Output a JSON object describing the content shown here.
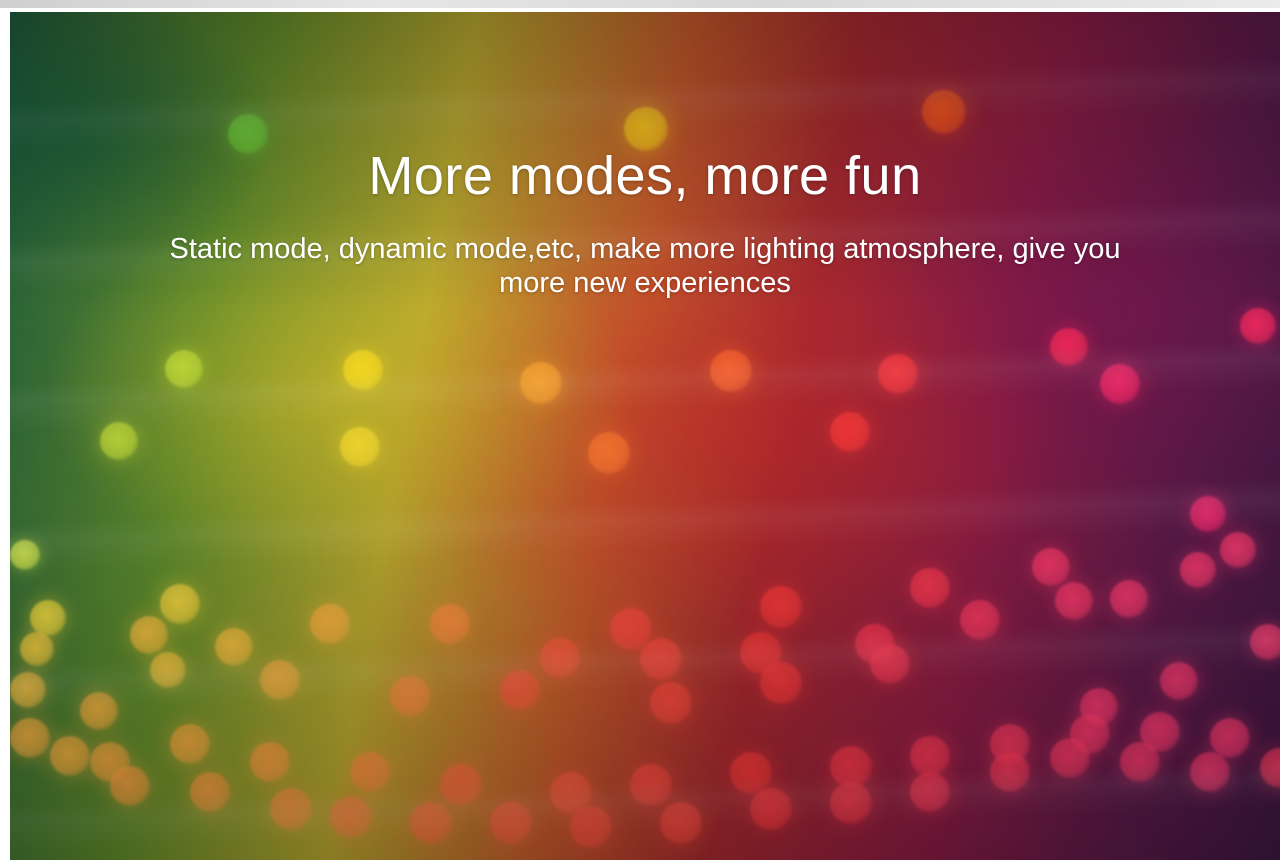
{
  "banner": {
    "headline": "More modes, more fun",
    "subtext": "Static mode, dynamic mode,etc, make more lighting atmosphere, give you more new experiences"
  },
  "colors": {
    "left_tone": "#1f5a3a",
    "mid_tone": "#b6a52e",
    "right_tone": "#5b1a48",
    "text": "#ffffff"
  }
}
